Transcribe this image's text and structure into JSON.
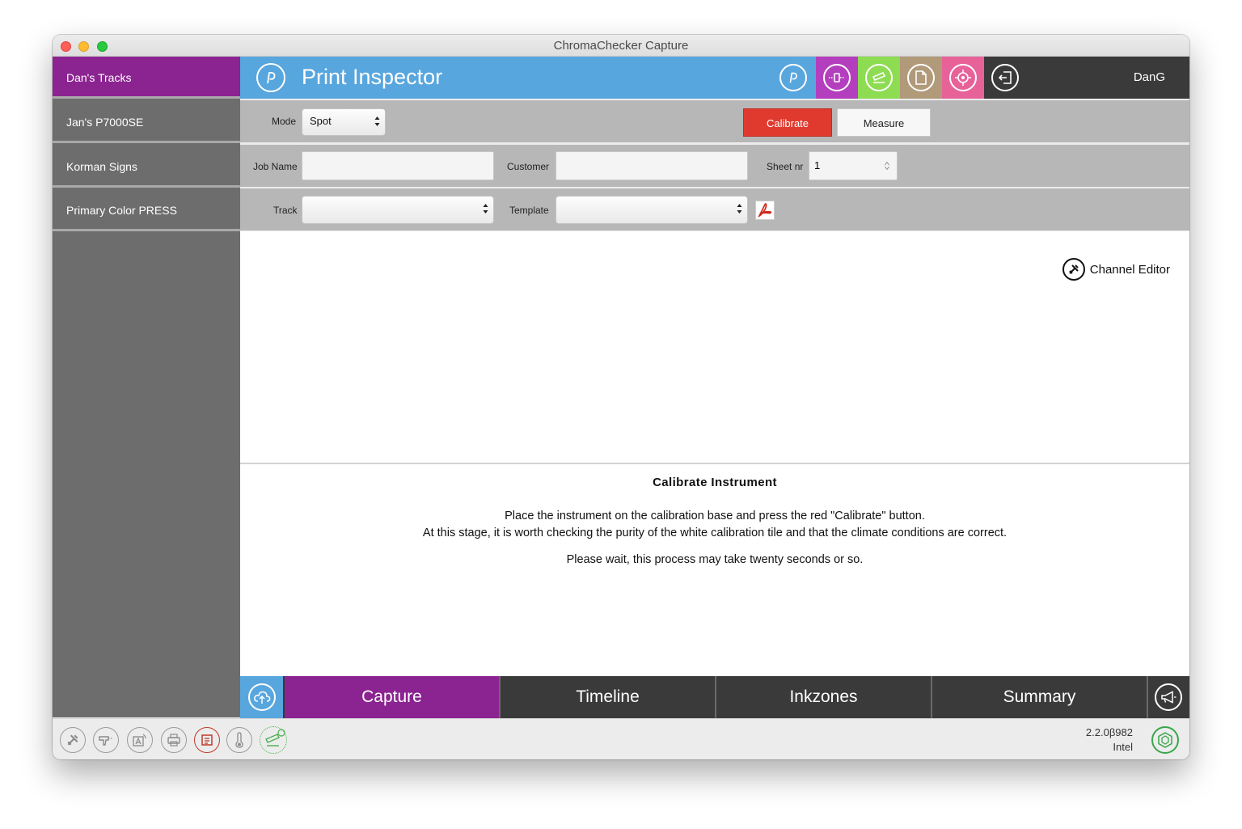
{
  "window": {
    "title": "ChromaChecker Capture"
  },
  "sidebar": {
    "items": [
      {
        "label": "Dan's Tracks",
        "active": true
      },
      {
        "label": "Jan's P7000SE",
        "active": false
      },
      {
        "label": "Korman Signs",
        "active": false
      },
      {
        "label": "Primary Color PRESS",
        "active": false
      }
    ]
  },
  "header": {
    "title": "Print Inspector",
    "user": "DanG",
    "icons": [
      "print-inspector-icon",
      "instrument-icon",
      "scanner-icon",
      "document-icon",
      "target-icon",
      "logout-icon"
    ],
    "colors": {
      "blue": "#58a6de",
      "purple": "#b43fbe",
      "green": "#8ddc52",
      "tan": "#b09a7a",
      "pink": "#e8629a",
      "dark": "#3a3a3a"
    }
  },
  "form": {
    "mode_label": "Mode",
    "mode_value": "Spot",
    "calibrate_label": "Calibrate",
    "measure_label": "Measure",
    "job_name_label": "Job Name",
    "job_name_value": "",
    "customer_label": "Customer",
    "customer_value": "",
    "sheet_label": "Sheet nr",
    "sheet_value": "1",
    "track_label": "Track",
    "track_value": "",
    "template_label": "Template",
    "template_value": ""
  },
  "main": {
    "channel_editor": "Channel Editor",
    "calibrate_title": "Calibrate Instrument",
    "line1": "Place the instrument on the calibration base and press the red \"Calibrate\" button.",
    "line2": "At this stage, it is worth checking the purity of the white calibration tile and that the climate conditions are correct.",
    "line3": "Please wait, this process may take twenty seconds or so."
  },
  "tabs": [
    {
      "label": "Capture",
      "active": true
    },
    {
      "label": "Timeline",
      "active": false
    },
    {
      "label": "Inkzones",
      "active": false
    },
    {
      "label": "Summary",
      "active": false
    }
  ],
  "status": {
    "version": "2.2.0β982",
    "arch": "Intel",
    "icons": [
      "tools-icon",
      "spectro-icon",
      "font-icon",
      "printer-icon",
      "report-icon",
      "thermometer-icon",
      "connection-icon"
    ]
  },
  "accent_colors": {
    "purple": "#8b2391",
    "red": "#e03a2f"
  }
}
